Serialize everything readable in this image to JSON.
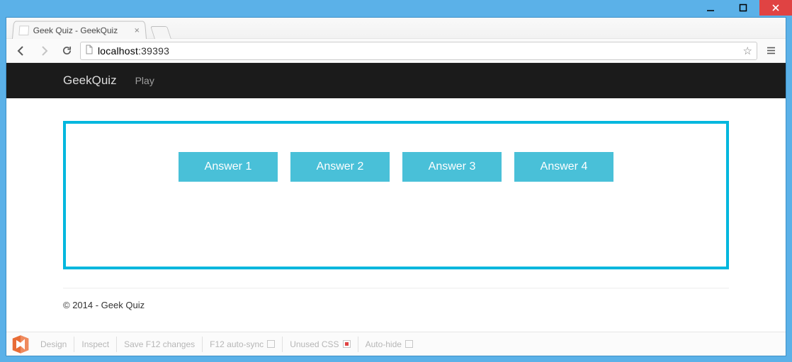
{
  "window": {
    "tab_title": "Geek Quiz - GeekQuiz",
    "url_host": "localhost",
    "url_port": ":39393"
  },
  "navbar": {
    "brand": "GeekQuiz",
    "play": "Play"
  },
  "quiz": {
    "answers": [
      "Answer 1",
      "Answer 2",
      "Answer 3",
      "Answer 4"
    ]
  },
  "footer": {
    "copyright": "© 2014 - Geek Quiz"
  },
  "devbar": {
    "design": "Design",
    "inspect": "Inspect",
    "save": "Save F12 changes",
    "autosync": "F12 auto-sync",
    "unused": "Unused CSS",
    "autohide": "Auto-hide"
  }
}
